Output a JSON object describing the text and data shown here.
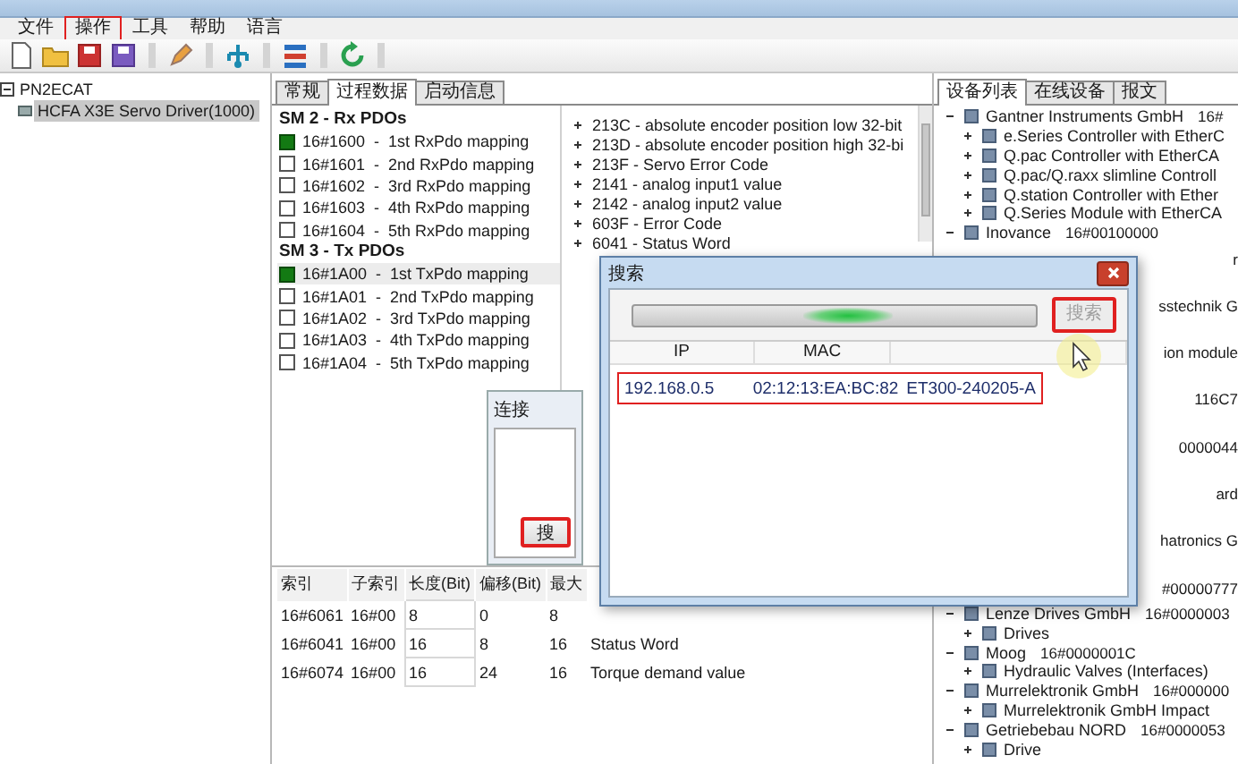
{
  "menu": [
    {
      "label": "文件",
      "annotated": false
    },
    {
      "label": "操作",
      "annotated": true
    },
    {
      "label": "工具",
      "annotated": false
    },
    {
      "label": "帮助",
      "annotated": false
    },
    {
      "label": "语言",
      "annotated": false
    }
  ],
  "project_tree": [
    {
      "label": "PN2ECAT",
      "expanded": true,
      "selected": false,
      "children": [
        {
          "label": "HCFA X3E Servo Driver(1000)",
          "selected": true
        }
      ]
    }
  ],
  "process_data": {
    "tabs": [
      {
        "label": "常规",
        "selected": false
      },
      {
        "label": "过程数据",
        "selected": true
      },
      {
        "label": "启动信息",
        "selected": false
      }
    ],
    "pdo_sections": [
      {
        "title": "SM 2 - Rx PDOs",
        "items": [
          {
            "text": "16#1600  -  1st RxPdo mapping",
            "checked": true,
            "selected": false
          },
          {
            "text": "16#1601  -  2nd RxPdo mapping",
            "checked": false,
            "selected": false
          },
          {
            "text": "16#1602  -  3rd RxPdo mapping",
            "checked": false,
            "selected": false
          },
          {
            "text": "16#1603  -  4th RxPdo mapping",
            "checked": false,
            "selected": false
          },
          {
            "text": "16#1604  -  5th RxPdo mapping",
            "checked": false,
            "selected": false
          }
        ]
      },
      {
        "title": "SM 3 - Tx PDOs",
        "items": [
          {
            "text": "16#1A00  -  1st TxPdo mapping",
            "checked": true,
            "selected": true
          },
          {
            "text": "16#1A01  -  2nd TxPdo mapping",
            "checked": false,
            "selected": false
          },
          {
            "text": "16#1A02  -  3rd TxPdo mapping",
            "checked": false,
            "selected": false
          },
          {
            "text": "16#1A03  -  4th TxPdo mapping",
            "checked": false,
            "selected": false
          },
          {
            "text": "16#1A04  -  5th TxPdo mapping",
            "checked": false,
            "selected": false
          }
        ]
      }
    ],
    "objects": [
      {
        "text": "213C - absolute encoder position low 32-bit",
        "expanded": false
      },
      {
        "text": "213D - absolute encoder position high 32-bi",
        "expanded": false
      },
      {
        "text": "213F - Servo Error Code",
        "expanded": false
      },
      {
        "text": "2141 - analog input1 value",
        "expanded": false
      },
      {
        "text": "2142 - analog input2 value",
        "expanded": false
      },
      {
        "text": "603F - Error Code",
        "expanded": false
      },
      {
        "text": "6041 - Status Word",
        "expanded": false
      }
    ],
    "mapping_table": {
      "columns": [
        {
          "label": "索引",
          "editable": false
        },
        {
          "label": "子索引",
          "editable": false
        },
        {
          "label": "长度(Bit)",
          "editable": true
        },
        {
          "label": "偏移(Bit)",
          "editable": false
        },
        {
          "label": "最大",
          "editable": false
        }
      ],
      "rows": [
        [
          "16#6061",
          "16#00",
          "8",
          "0",
          "8"
        ],
        [
          "16#6041",
          "16#00",
          "16",
          "8",
          "16",
          "Status Word"
        ],
        [
          "16#6074",
          "16#00",
          "16",
          "24",
          "16",
          "Torque demand value"
        ]
      ]
    }
  },
  "device_panel": {
    "tabs": [
      {
        "label": "设备列表",
        "selected": true
      },
      {
        "label": "在线设备",
        "selected": false
      },
      {
        "label": "报文",
        "selected": false
      }
    ],
    "tree": [
      {
        "label": "Gantner Instruments GmbH",
        "code": "16#",
        "expanded": true,
        "children": [
          {
            "label": "e.Series Controller with EtherC",
            "expanded": false
          },
          {
            "label": "Q.pac Controller with EtherCA",
            "expanded": false
          },
          {
            "label": "Q.pac/Q.raxx slimline Controll",
            "expanded": false
          },
          {
            "label": "Q.station Controller with Ether",
            "expanded": false
          },
          {
            "label": "Q.Series Module with EtherCA",
            "expanded": false
          }
        ]
      },
      {
        "label": "Inovance",
        "code": "16#00100000",
        "expanded": true
      }
    ],
    "covered_row_ends": [
      "r",
      "sstechnik G",
      "ion module",
      "116C7",
      "0000044",
      "ard",
      "hatronics G",
      "#00000777"
    ],
    "tree_below": [
      {
        "label": "Lenze Drives GmbH",
        "code": "16#0000003",
        "expanded": true,
        "children": [
          {
            "label": "Drives",
            "expanded": false
          }
        ]
      },
      {
        "label": "Moog",
        "code": "16#0000001C",
        "expanded": true,
        "children": [
          {
            "label": "Hydraulic Valves (Interfaces)",
            "expanded": false
          }
        ]
      },
      {
        "label": "Murrelektronik GmbH",
        "code": "16#000000",
        "expanded": true,
        "children": [
          {
            "label": "Murrelektronik GmbH Impact",
            "expanded": false
          }
        ]
      },
      {
        "label": "Getriebebau NORD",
        "code": "16#0000053",
        "expanded": true,
        "children": [
          {
            "label": "Drive",
            "expanded": false
          }
        ]
      }
    ]
  },
  "connect_dialog": {
    "title": "连接",
    "button": {
      "label": "搜",
      "annotated": true
    }
  },
  "search_dialog": {
    "title": "搜索",
    "button": {
      "label": "搜索",
      "disabled": true,
      "annotated": true
    },
    "columns": [
      "IP",
      "MAC"
    ],
    "results": [
      {
        "cells": [
          "192.168.0.5",
          "02:12:13:EA:BC:82",
          "ET300-240205-A"
        ],
        "annotated": true
      }
    ]
  }
}
